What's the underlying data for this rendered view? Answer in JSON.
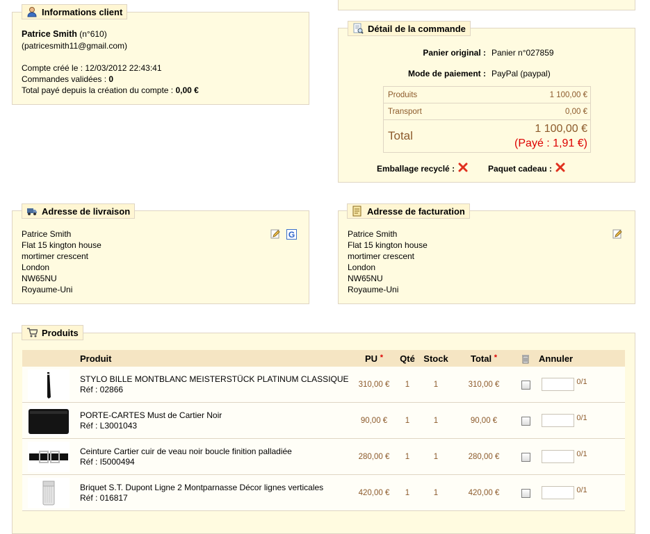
{
  "client": {
    "legend": "Informations client",
    "name": "Patrice Smith",
    "number": "(n°610)",
    "email": "(patricesmith11@gmail.com)",
    "created_label": "Compte créé le :",
    "created_value": "12/03/2012 22:43:41",
    "orders_label": "Commandes validées :",
    "orders_value": "0",
    "total_label": "Total payé depuis la création du compte :",
    "total_value": "0,00 €"
  },
  "order": {
    "legend": "Détail de la commande",
    "cart_label": "Panier original :",
    "cart_value": "Panier n°027859",
    "payment_label": "Mode de paiement :",
    "payment_value": "PayPal (paypal)",
    "products_label": "Produits",
    "products_value": "1 100,00 €",
    "shipping_label": "Transport",
    "shipping_value": "0,00 €",
    "total_label": "Total",
    "total_value": "1 100,00 €",
    "paid_value": "(Payé : 1,91 €)",
    "recycled_label": "Emballage recyclé :",
    "gift_label": "Paquet cadeau :"
  },
  "delivery": {
    "legend": "Adresse de livraison",
    "lines": [
      "Patrice Smith",
      "Flat 15 kington house",
      "mortimer crescent",
      "London",
      "NW65NU",
      "Royaume-Uni"
    ]
  },
  "invoice": {
    "legend": "Adresse de facturation",
    "lines": [
      "Patrice Smith",
      "Flat 15 kington house",
      "mortimer crescent",
      "London",
      "NW65NU",
      "Royaume-Uni"
    ]
  },
  "products": {
    "legend": "Produits",
    "headers": {
      "product": "Produit",
      "unit_price": "PU",
      "qty": "Qté",
      "stock": "Stock",
      "total": "Total",
      "cancel": "Annuler",
      "required_mark": "*"
    },
    "rows": [
      {
        "name": "STYLO BILLE MONTBLANC MEISTERSTÜCK PLATINUM CLASSIQUE",
        "ref": "Réf : 02866",
        "unit_price": "310,00 €",
        "qty": "1",
        "stock": "1",
        "total": "310,00 €",
        "cancel_max": "0/1",
        "thumb": "pen"
      },
      {
        "name": "PORTE-CARTES Must de Cartier Noir",
        "ref": "Réf : L3001043",
        "unit_price": "90,00 €",
        "qty": "1",
        "stock": "1",
        "total": "90,00 €",
        "cancel_max": "0/1",
        "thumb": "wallet"
      },
      {
        "name": "Ceinture Cartier cuir de veau noir boucle finition palladiée",
        "ref": "Réf : I5000494",
        "unit_price": "280,00 €",
        "qty": "1",
        "stock": "1",
        "total": "280,00 €",
        "cancel_max": "0/1",
        "thumb": "belt"
      },
      {
        "name": "Briquet S.T. Dupont Ligne 2 Montparnasse Décor lignes verticales",
        "ref": "Réf : 016817",
        "unit_price": "420,00 €",
        "qty": "1",
        "stock": "1",
        "total": "420,00 €",
        "cancel_max": "0/1",
        "thumb": "lighter"
      }
    ]
  },
  "colors": {
    "panel_bg": "#fffbe0",
    "border": "#dfd5c3",
    "header_bg": "#f5e5c3",
    "price_brown": "#8c5a2b",
    "alert_red": "#dd0000"
  }
}
